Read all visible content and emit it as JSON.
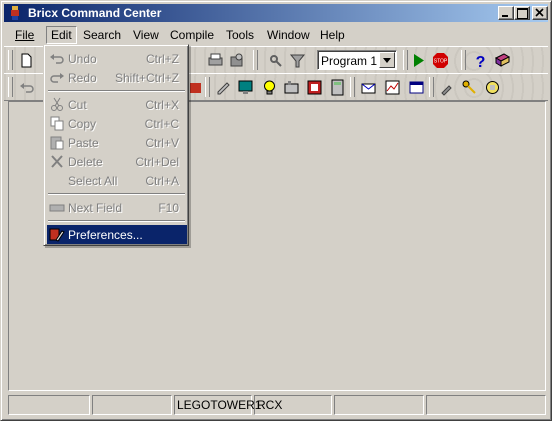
{
  "window": {
    "title": "Bricx Command Center"
  },
  "menubar": {
    "items": [
      "File",
      "Edit",
      "Search",
      "View",
      "Compile",
      "Tools",
      "Window",
      "Help"
    ]
  },
  "toolbar": {
    "program_select": "Program 1"
  },
  "edit_menu": {
    "items": [
      {
        "label": "Undo",
        "shortcut": "Ctrl+Z",
        "icon": "undo-icon"
      },
      {
        "label": "Redo",
        "shortcut": "Shift+Ctrl+Z",
        "icon": "redo-icon"
      },
      {
        "label": "Cut",
        "shortcut": "Ctrl+X",
        "icon": "scissors-icon"
      },
      {
        "label": "Copy",
        "shortcut": "Ctrl+C",
        "icon": "copy-icon"
      },
      {
        "label": "Paste",
        "shortcut": "Ctrl+V",
        "icon": "paste-icon"
      },
      {
        "label": "Delete",
        "shortcut": "Ctrl+Del",
        "icon": "delete-icon"
      },
      {
        "label": "Select All",
        "shortcut": "Ctrl+A",
        "icon": ""
      },
      {
        "label": "Next Field",
        "shortcut": "F10",
        "icon": "next-field-icon"
      },
      {
        "label": "Preferences...",
        "shortcut": "",
        "icon": "preferences-icon"
      }
    ]
  },
  "statusbar": {
    "panels": [
      "",
      "",
      "LEGOTOWER1",
      "RCX",
      "",
      ""
    ]
  }
}
